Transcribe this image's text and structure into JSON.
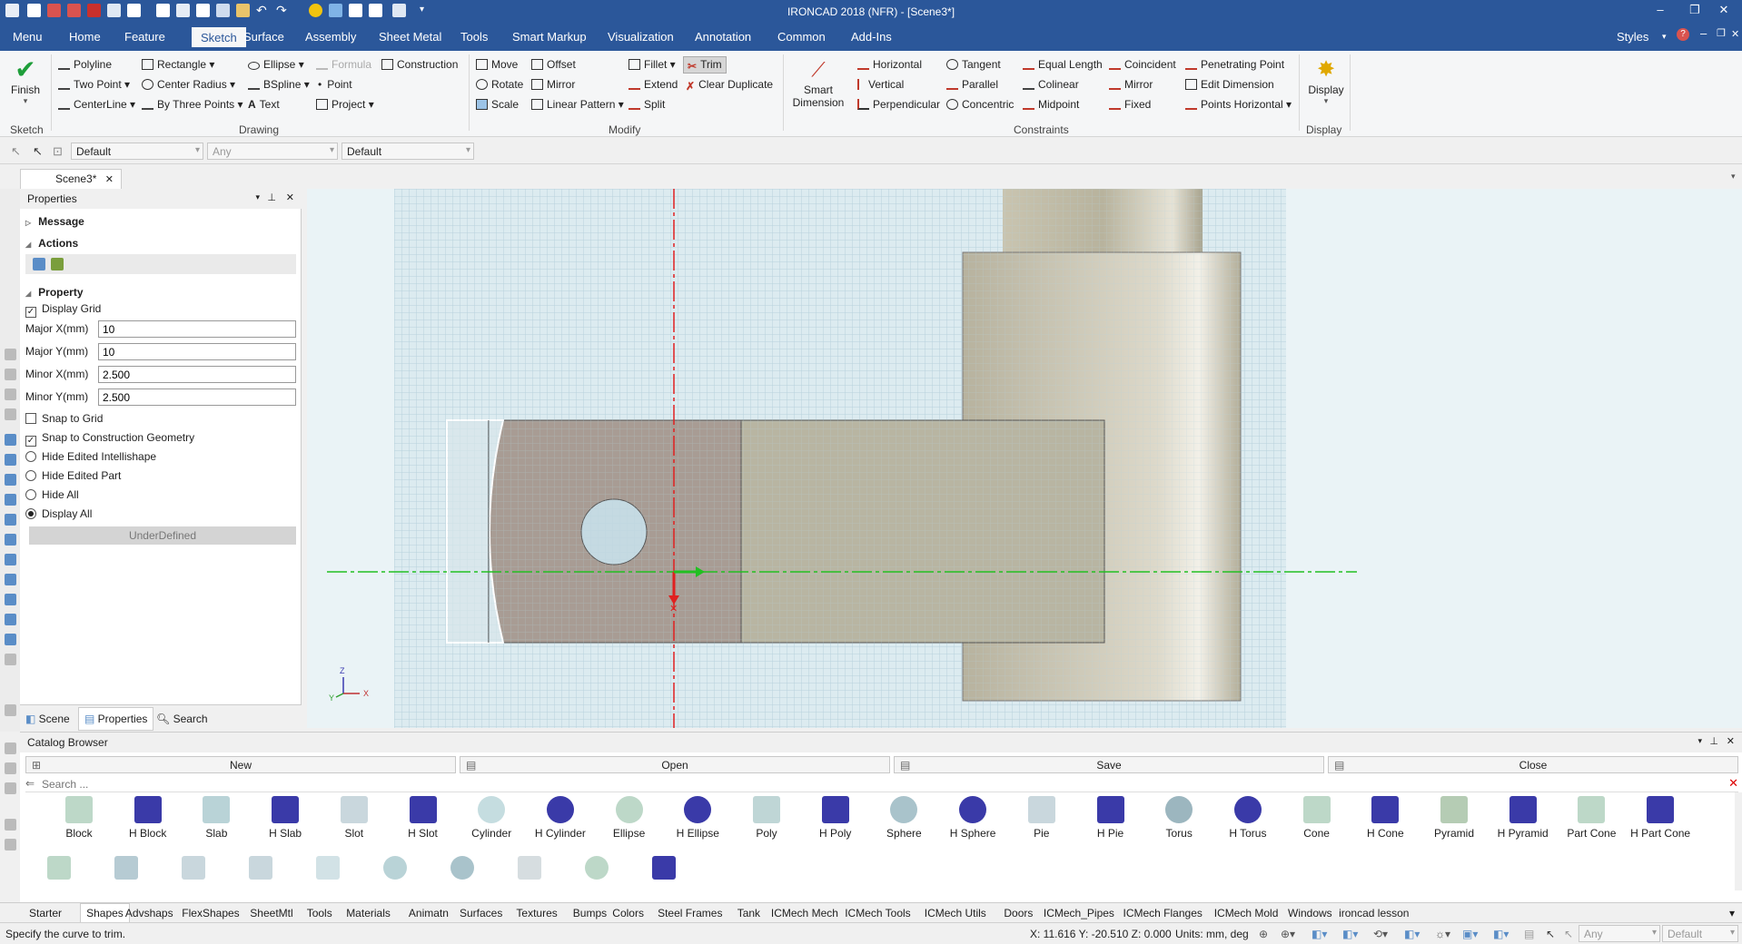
{
  "window": {
    "title": "IRONCAD 2018 (NFR) - [Scene3*]",
    "styles_label": "Styles"
  },
  "menu": {
    "items": [
      "Menu",
      "Home",
      "Feature",
      "Sketch",
      "Surface",
      "Assembly",
      "Sheet Metal",
      "Tools",
      "Smart Markup",
      "Visualization",
      "Annotation",
      "Common",
      "Add-Ins"
    ],
    "active": "Sketch"
  },
  "ribbon": {
    "finish": "Finish",
    "drawing": {
      "polyline": "Polyline",
      "two_point": "Two Point",
      "centerline": "CenterLine",
      "rectangle": "Rectangle",
      "center_radius": "Center Radius",
      "by_three_points": "By Three Points",
      "ellipse": "Ellipse",
      "bspline": "BSpline",
      "text": "Text",
      "formula": "Formula",
      "point": "Point",
      "project": "Project",
      "construction": "Construction"
    },
    "modify": {
      "move": "Move",
      "rotate": "Rotate",
      "scale": "Scale",
      "offset": "Offset",
      "mirror": "Mirror",
      "linear_pattern": "Linear Pattern",
      "fillet": "Fillet",
      "extend": "Extend",
      "split": "Split",
      "trim": "Trim",
      "clear_duplicate": "Clear Duplicate"
    },
    "smart_dimension": "Smart Dimension",
    "constraints": {
      "horizontal": "Horizontal",
      "vertical": "Vertical",
      "perpendicular": "Perpendicular",
      "tangent": "Tangent",
      "parallel": "Parallel",
      "concentric": "Concentric",
      "equal_length": "Equal Length",
      "colinear": "Colinear",
      "midpoint": "Midpoint",
      "coincident": "Coincident",
      "mirror": "Mirror",
      "fixed": "Fixed",
      "penetrating_point": "Penetrating Point",
      "edit_dimension": "Edit Dimension",
      "points_horizontal": "Points Horizontal"
    },
    "display": "Display",
    "groups": {
      "sketch": "Sketch",
      "drawing": "Drawing",
      "modify": "Modify",
      "constraints": "Constraints",
      "display": "Display"
    }
  },
  "toolbar2": {
    "combo1": "Default",
    "combo2": "Any",
    "combo3": "Default"
  },
  "doc_tab": "Scene3*",
  "properties": {
    "title": "Properties",
    "message": "Message",
    "actions": "Actions",
    "property": "Property",
    "display_grid": "Display Grid",
    "major_x_label": "Major X(mm)",
    "major_x": "10",
    "major_y_label": "Major Y(mm)",
    "major_y": "10",
    "minor_x_label": "Minor X(mm)",
    "minor_x": "2.500",
    "minor_y_label": "Minor Y(mm)",
    "minor_y": "2.500",
    "snap_grid": "Snap to Grid",
    "snap_construction": "Snap to Construction Geometry",
    "hide_intellishape": "Hide Edited Intellishape",
    "hide_part": "Hide Edited Part",
    "hide_all": "Hide All",
    "display_all": "Display All",
    "status": "UnderDefined",
    "tabs": {
      "scene": "Scene",
      "properties": "Properties",
      "search": "Search"
    }
  },
  "triad": {
    "z": "Z",
    "x": "X",
    "y": "Y"
  },
  "catalog": {
    "title": "Catalog Browser",
    "new": "New",
    "open": "Open",
    "save": "Save",
    "close": "Close",
    "search_placeholder": "Search ...",
    "items": [
      "Block",
      "H Block",
      "Slab",
      "H Slab",
      "Slot",
      "H Slot",
      "Cylinder",
      "H Cylinder",
      "Ellipse",
      "H Ellipse",
      "Poly",
      "H Poly",
      "Sphere",
      "H Sphere",
      "Pie",
      "H Pie",
      "Torus",
      "H Torus",
      "Cone",
      "H Cone",
      "Pyramid",
      "H Pyramid",
      "Part Cone",
      "H Part Cone"
    ]
  },
  "bottom_tabs": [
    "Starter",
    "Shapes",
    "Advshaps",
    "FlexShapes",
    "SheetMtl",
    "Tools",
    "Materials",
    "Animatn",
    "Surfaces",
    "Textures",
    "Bumps",
    "Colors",
    "Steel Frames",
    "Tank",
    "ICMech Mech",
    "ICMech Tools",
    "ICMech Utils",
    "Doors",
    "ICMech_Pipes",
    "ICMech Flanges",
    "ICMech Mold",
    "Windows",
    "ironcad lesson"
  ],
  "bottom_active": "Shapes",
  "status": {
    "message": "Specify the curve to trim.",
    "coords": "X: 11.616 Y: -20.510 Z: 0.000",
    "units": "Units: mm, deg",
    "combo_any": "Any",
    "combo_default": "Default"
  }
}
